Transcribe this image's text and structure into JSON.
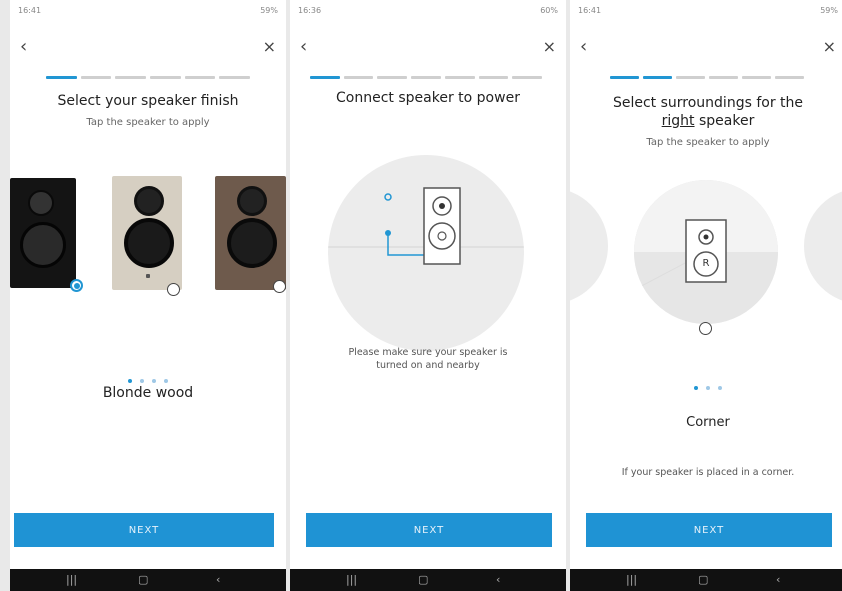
{
  "screens": [
    {
      "status": {
        "time": "16:41",
        "right": "59%"
      },
      "progress": {
        "total": 6,
        "active": 1
      },
      "title": "Select your speaker finish",
      "subtitle": "Tap the speaker to apply",
      "finishes": [
        "black",
        "blonde",
        "walnut"
      ],
      "selected_finish_index": 0,
      "carousel_dots": 4,
      "selected_name": "Blonde wood",
      "next_label": "NEXT"
    },
    {
      "status": {
        "time": "16:36",
        "right": "60%"
      },
      "progress": {
        "total": 7,
        "active": 1
      },
      "title": "Connect speaker to power",
      "message_line1": "Please make sure your speaker is",
      "message_line2": "turned on and nearby",
      "next_label": "NEXT"
    },
    {
      "status": {
        "time": "16:41",
        "right": "59%"
      },
      "progress": {
        "total": 6,
        "active": 2
      },
      "title_line1": "Select surroundings for the",
      "title_line2_underlined": "right",
      "title_line2_rest": " speaker",
      "subtitle": "Tap the speaker to apply",
      "speaker_letter": "R",
      "carousel_dots": 3,
      "selected_name": "Corner",
      "description": "If your speaker is placed in a corner.",
      "next_label": "NEXT"
    }
  ],
  "colors": {
    "accent": "#2196d3",
    "button": "#1f93d4"
  },
  "icons": [
    "back-arrow-icon",
    "close-icon",
    "recent-apps-icon",
    "home-icon",
    "back-nav-icon"
  ]
}
